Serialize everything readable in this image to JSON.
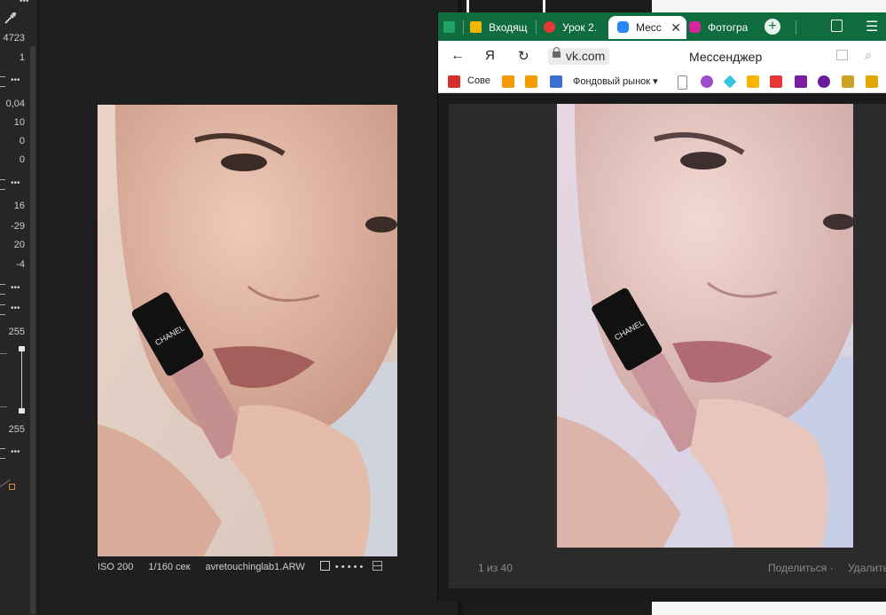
{
  "editor": {
    "panel_values": {
      "v1": "4723",
      "v2": "1",
      "v3": "0,04",
      "v4": "10",
      "v5": "0",
      "v6": "0",
      "v7": "16",
      "v8": "-29",
      "v9": "20",
      "v10": "-4",
      "v11": "255",
      "v12": "255"
    },
    "info": {
      "iso": "ISO 200",
      "shutter": "1/160 сек",
      "filename": "avretouchinglab1.ARW"
    },
    "rating_dots": "• • • • •"
  },
  "browser": {
    "tabs": [
      {
        "label": "",
        "icon": "sheets-icon",
        "color": "#21a366"
      },
      {
        "label": "Входящ",
        "icon": "mail-icon",
        "color": "#f2b705"
      },
      {
        "label": "Урок 2.",
        "icon": "lesson-icon",
        "color": "#e53935"
      },
      {
        "label": "Месс",
        "icon": "messenger-icon",
        "color": "#2787f5"
      },
      {
        "label": "Фотогра",
        "icon": "instagram-icon",
        "color": "#d6249f"
      }
    ],
    "url": "vk.com",
    "page_title": "Мессенджер",
    "bookmarks": {
      "b1": "Сове",
      "b2": "Фондовый рынок ▾"
    },
    "viewer": {
      "counter": "1 из 40",
      "share": "Поделиться ·",
      "delete": "Удалить"
    }
  },
  "colors": {
    "tab_bar": "#0f6c3f",
    "accent_curve": "#e08a3a"
  }
}
